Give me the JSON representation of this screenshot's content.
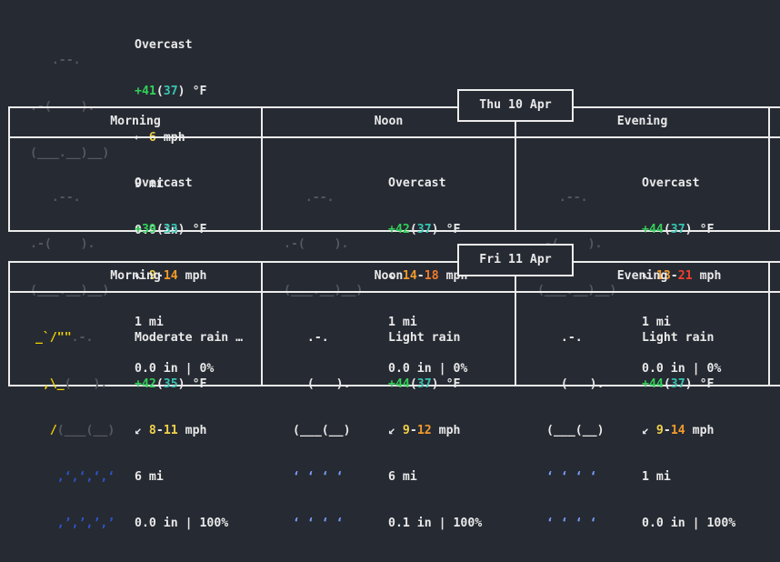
{
  "current": {
    "art": [
      "   .--.   ",
      ".-(    ). ",
      "(___.__)__)"
    ],
    "condition": "Overcast",
    "temp": "+41",
    "feels": "37",
    "unit": "°F",
    "wind_dir": "←",
    "wind_speed": "6",
    "wind_unit": "mph",
    "visibility": "9 mi",
    "precip": "0.0 in"
  },
  "days": [
    {
      "date": "Thu 10 Apr",
      "periods": [
        {
          "name": "Morning",
          "icon": "cloud-icon",
          "art": [
            "   .--.   ",
            ".-(    ). ",
            "(___.__)__)"
          ],
          "condition": "Overcast",
          "temp": "+39",
          "feels": "33",
          "unit": "°F",
          "wind_dir": "↖",
          "wind_low": "9",
          "wind_high": "14",
          "wind_unit": "mph",
          "visibility": "1 mi",
          "precip": "0.0 in | 0%"
        },
        {
          "name": "Noon",
          "icon": "cloud-icon",
          "art": [
            "   .--.   ",
            ".-(    ). ",
            "(___.__)__)"
          ],
          "condition": "Overcast",
          "temp": "+42",
          "feels": "37",
          "unit": "°F",
          "wind_dir": "↖",
          "wind_low": "14",
          "wind_high": "18",
          "wind_unit": "mph",
          "visibility": "1 mi",
          "precip": "0.0 in | 0%"
        },
        {
          "name": "Evening",
          "icon": "cloud-icon",
          "art": [
            "   .--.   ",
            ".-(    ). ",
            "(___.__)__)"
          ],
          "condition": "Overcast",
          "temp": "+44",
          "feels": "37",
          "unit": "°F",
          "wind_dir": "↖",
          "wind_low": "13",
          "wind_high": "21",
          "wind_unit": "mph",
          "visibility": "1 mi",
          "precip": "0.0 in | 0%"
        }
      ]
    },
    {
      "date": "Fri 11 Apr",
      "periods": [
        {
          "name": "Morning",
          "icon": "sun-rain-icon",
          "condition": "Moderate rain …",
          "temp": "+42",
          "feels": "35",
          "unit": "°F",
          "wind_dir": "↙",
          "wind_low": "8",
          "wind_high": "11",
          "wind_unit": "mph",
          "visibility": "6 mi",
          "precip": "0.0 in | 100%"
        },
        {
          "name": "Noon",
          "icon": "rain-cloud-icon",
          "art": [
            "  .-.  ",
            "  (   ). ",
            "(___(__)",
            "‘ ‘ ‘ ‘ ",
            "‘ ‘ ‘ ‘ "
          ],
          "condition": "Light rain",
          "temp": "+44",
          "feels": "37",
          "unit": "°F",
          "wind_dir": "↙",
          "wind_low": "9",
          "wind_high": "12",
          "wind_unit": "mph",
          "visibility": "6 mi",
          "precip": "0.1 in | 100%"
        },
        {
          "name": "Evening",
          "icon": "rain-cloud-icon",
          "art": [
            "  .-.  ",
            "  (   ). ",
            "(___(__)",
            "‘ ‘ ‘ ‘ ",
            "‘ ‘ ‘ ‘ "
          ],
          "condition": "Light rain",
          "temp": "+44",
          "feels": "37",
          "unit": "°F",
          "wind_dir": "↙",
          "wind_low": "9",
          "wind_high": "14",
          "wind_unit": "mph",
          "visibility": "1 mi",
          "precip": "0.0 in | 100%"
        }
      ]
    }
  ]
}
